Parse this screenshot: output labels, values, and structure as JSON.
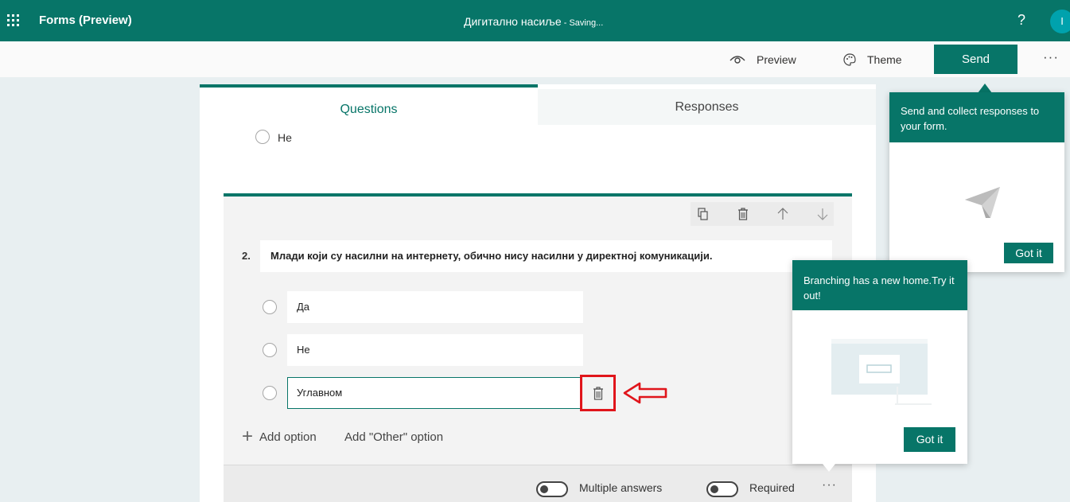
{
  "app": {
    "name": "Forms (Preview)",
    "doc_title": "Дигитално насиље",
    "separator": " - ",
    "status": "Saving...",
    "help": "?",
    "avatar_initial": "I"
  },
  "commands": {
    "preview": "Preview",
    "theme": "Theme",
    "send": "Send",
    "more": "···"
  },
  "tabs": {
    "questions": "Questions",
    "responses": "Responses"
  },
  "previous_question": {
    "last_option": "Не"
  },
  "question": {
    "number": "2.",
    "title": "Млади који су насилни на интернету, обично нису насилни у директној комуникацији.",
    "options": [
      "Да",
      "Не",
      "Углавном"
    ],
    "add_option": "Add option",
    "add_other": "Add \"Other\" option",
    "multiple_answers_label": "Multiple answers",
    "multiple_answers": false,
    "required_label": "Required",
    "required": false,
    "more": "···"
  },
  "popovers": {
    "send": {
      "text": "Send and collect responses to your form.",
      "button": "Got it"
    },
    "branching": {
      "text": "Branching has a new home.Try it out!",
      "button": "Got it"
    }
  },
  "colors": {
    "brand": "#077568",
    "annotation": "#e0151b"
  }
}
